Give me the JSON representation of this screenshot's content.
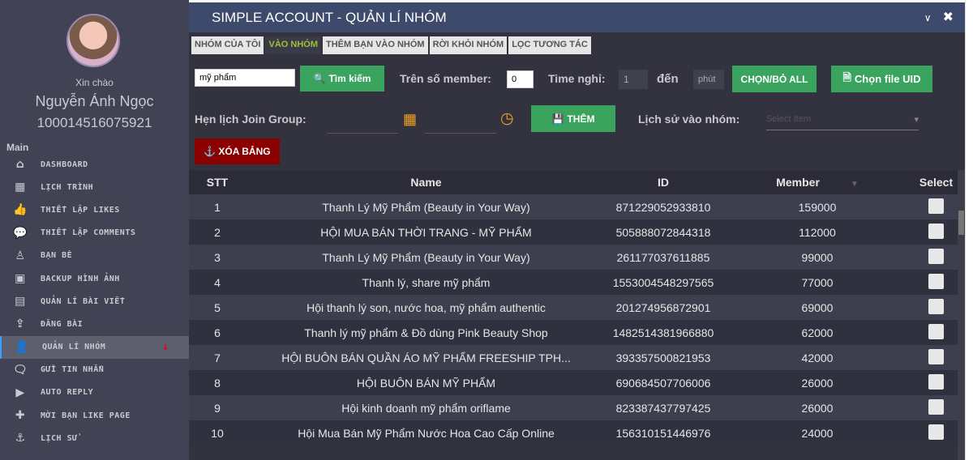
{
  "sidebar": {
    "greeting": "Xin chào",
    "user_name": "Nguyễn Ánh Ngọc",
    "user_id": "100014516075921",
    "section": "Main",
    "items": [
      {
        "label": "DASHBOARD",
        "icon": "home-icon",
        "glyph": "⌂"
      },
      {
        "label": "LỊCH TRÌNH",
        "icon": "calendar-icon",
        "glyph": "▦"
      },
      {
        "label": "THIẾT LẬP LIKES",
        "icon": "thumbs-up-icon",
        "glyph": "👍"
      },
      {
        "label": "THIẾT LẬP COMMENTS",
        "icon": "comment-icon",
        "glyph": "💬"
      },
      {
        "label": "BẠN BÈ",
        "icon": "person-icon",
        "glyph": "♙"
      },
      {
        "label": "BACKUP HÌNH ẢNH",
        "icon": "image-icon",
        "glyph": "▣"
      },
      {
        "label": "QUẢN LÍ BÀI VIẾT",
        "icon": "newspaper-icon",
        "glyph": "▤"
      },
      {
        "label": "ĐĂNG BÀI",
        "icon": "upload-icon",
        "glyph": "⇪"
      },
      {
        "label": "QUẢN LÍ NHÓM",
        "icon": "user-icon",
        "glyph": "👤",
        "active": true
      },
      {
        "label": "GỬI TIN NHẮN",
        "icon": "comments-icon",
        "glyph": "🗨"
      },
      {
        "label": "AUTO REPLY",
        "icon": "play-icon",
        "glyph": "▶"
      },
      {
        "label": "MỜI BẠN LIKE PAGE",
        "icon": "plus-icon",
        "glyph": "✚"
      },
      {
        "label": "LỊCH SỬ",
        "icon": "anchor-icon",
        "glyph": "⚓"
      }
    ]
  },
  "modal": {
    "title": "SIMPLE ACCOUNT - QUẢN LÍ NHÓM",
    "tabs": [
      "NHÓM CỦA TÔI",
      "VÀO NHÓM",
      "THÊM BẠN VÀO NHÓM",
      "RỜI KHỎI NHÓM",
      "LỌC TƯƠNG TÁC"
    ],
    "active_tab": "VÀO NHÓM",
    "search_value": "mỹ phẩm",
    "search_button": "Tìm kiếm",
    "member_label": "Trên số member:",
    "member_value": "0",
    "time_label": "Time nghỉ:",
    "time_from": "1",
    "to_label": "đến",
    "unit": "phút",
    "select_all": "CHỌN/BỎ ALL",
    "choose_file": "Chọn file UID",
    "schedule_label": "Hẹn lịch Join Group:",
    "add_button": "THÊM",
    "history_label": "Lịch sử vào nhóm:",
    "history_placeholder": "Select Item",
    "clear_button": "XÓA BẢNG"
  },
  "table": {
    "headers": [
      "STT",
      "Name",
      "ID",
      "Member",
      "Select"
    ],
    "rows": [
      [
        "1",
        "Thanh Lý Mỹ Phẩm (Beauty in Your Way)",
        "871229052933810",
        "159000"
      ],
      [
        "2",
        "HỘI MUA BÁN THỜI TRANG - MỸ PHẨM",
        "505888072844318",
        "112000"
      ],
      [
        "3",
        "Thanh Lý Mỹ Phẩm (Beauty in Your Way)",
        "261177037611885",
        "99000"
      ],
      [
        "4",
        "Thanh lý, share mỹ phẩm",
        "1553004548297565",
        "77000"
      ],
      [
        "5",
        "Hội thanh lý son, nước hoa, mỹ phẩm authentic",
        "201274956872901",
        "69000"
      ],
      [
        "6",
        "Thanh lý mỹ phẩm & Đồ dùng Pink Beauty Shop",
        "1482514381966880",
        "62000"
      ],
      [
        "7",
        "HỘI BUÔN BÁN QUẦN ÁO MỸ PHẨM FREESHIP TPH...",
        "393357500821953",
        "42000"
      ],
      [
        "8",
        "HỘI BUÔN BÁN MỸ PHẨM",
        "690684507706006",
        "26000"
      ],
      [
        "9",
        "Hội kinh doanh mỹ phẩm oriflame",
        "823387437797425",
        "26000"
      ],
      [
        "10",
        "Hội Mua Bán Mỹ Phẩm Nước Hoa Cao Cấp Online",
        "156310151446976",
        "24000"
      ]
    ]
  },
  "colors": {
    "accent_green": "#3aa35e",
    "danger": "#8b0000",
    "header": "#3d4a6b",
    "active_tab": "#9cc23a"
  }
}
